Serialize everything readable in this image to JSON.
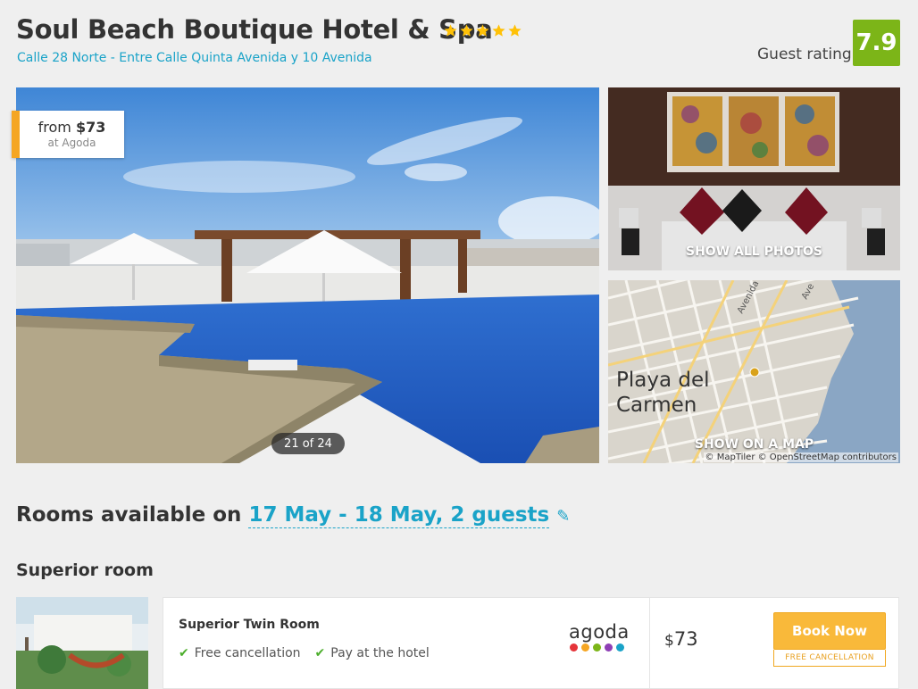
{
  "hotel": {
    "name": "Soul Beach Boutique Hotel & Spa",
    "star_count": 5,
    "address": "Calle 28 Norte - Entre Calle Quinta Avenida y 10 Avenida",
    "guest_rating_label": "Guest rating",
    "guest_rating_value": "7.9"
  },
  "gallery": {
    "price_from_prefix": "from",
    "price_from_value": "$73",
    "price_source": "at Agoda",
    "counter": "21 of 24",
    "show_all_photos": "SHOW ALL PHOTOS"
  },
  "map": {
    "city_line1": "Playa del",
    "city_line2": "Carmen",
    "show_on_map": "SHOW ON A MAP",
    "attribution": "© MapTiler © OpenStreetMap contributors",
    "street_a": "Avenida",
    "street_b": "Ave"
  },
  "rooms": {
    "heading_prefix": "Rooms available on",
    "dates_guests": "17 May - 18 May, 2 guests",
    "room_type": "Superior room",
    "offers": [
      {
        "name": "Superior Twin Room",
        "features": [
          "Free cancellation",
          "Pay at the hotel"
        ],
        "provider": "agoda",
        "currency": "$",
        "price": "73",
        "book_label": "Book Now",
        "cancel_note": "FREE CANCELLATION"
      }
    ]
  },
  "colors": {
    "accent": "#1aa3c8",
    "rating_green": "#7cb518",
    "book_orange": "#f9b93a",
    "star_yellow": "#ffc107"
  },
  "agoda_dots": [
    "#e5343a",
    "#f5a623",
    "#7cb518",
    "#8e3fb5",
    "#1aa3c8"
  ]
}
